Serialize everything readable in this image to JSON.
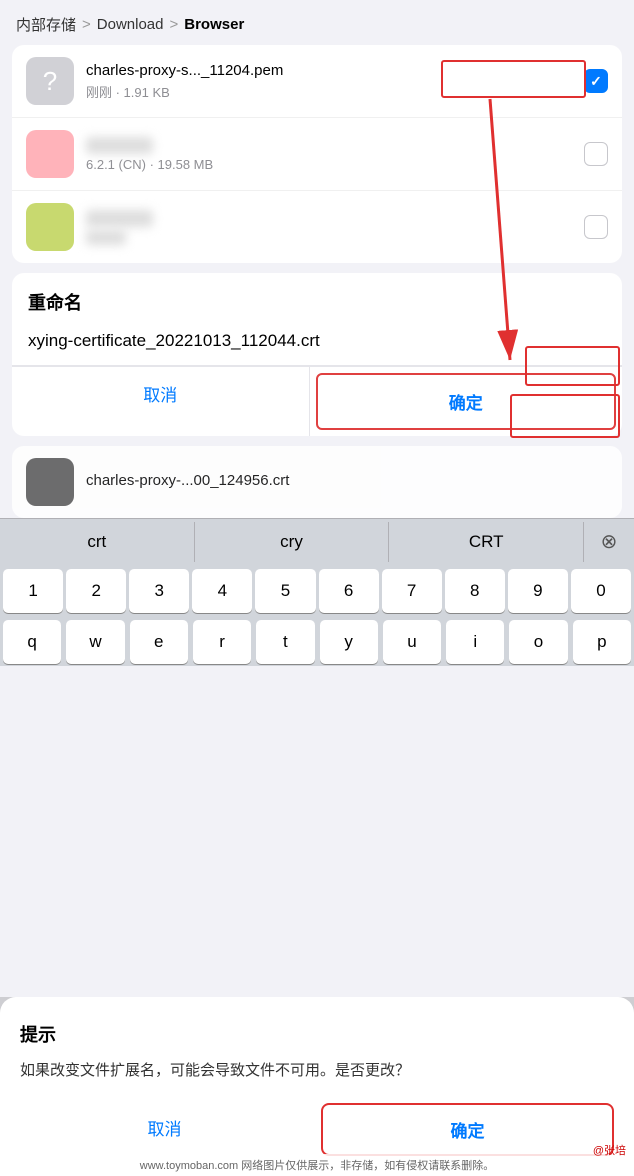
{
  "breadcrumb": {
    "part1": "内部存储",
    "sep1": ">",
    "part2": "Download",
    "sep2": ">",
    "part3": "Browser"
  },
  "files": [
    {
      "id": "file1",
      "icon_type": "gray",
      "icon_char": "?",
      "name": "charles-proxy-s..._11204.pem",
      "meta": "刚刚 · 1.91 KB",
      "checked": true
    },
    {
      "id": "file2",
      "icon_type": "pink",
      "icon_char": "",
      "name_blurred": "██████████",
      "meta_prefix": "",
      "meta": "6.2.1 (CN) · 19.58 MB",
      "checked": false
    },
    {
      "id": "file3",
      "icon_type": "yellow",
      "icon_char": "",
      "name_blurred": "██████████",
      "meta_blurred": "██████████",
      "checked": false
    }
  ],
  "rename_dialog": {
    "title": "重命名",
    "input_value": "xying-certificate_20221013_112044.crt",
    "cancel_label": "取消",
    "confirm_label": "确定"
  },
  "partial_file": {
    "name": "charles-proxy-...00_124956.crt",
    "icon_type": "dark"
  },
  "autocomplete": {
    "items": [
      "crt",
      "cry",
      "CRT"
    ],
    "dismiss": "⊗"
  },
  "keyboard_row1": [
    "q",
    "w",
    "e",
    "r",
    "t",
    "y",
    "u",
    "i",
    "o",
    "p"
  ],
  "alert_dialog": {
    "title": "提示",
    "message": "如果改变文件扩展名，可能会导致文件不可用。是否更改？",
    "cancel_label": "取消",
    "confirm_label": "确定"
  },
  "watermark": "www.toymoban.com 网络图片仅供展示，非存储，如有侵权请联系删除。",
  "csdn_label": "@张培"
}
